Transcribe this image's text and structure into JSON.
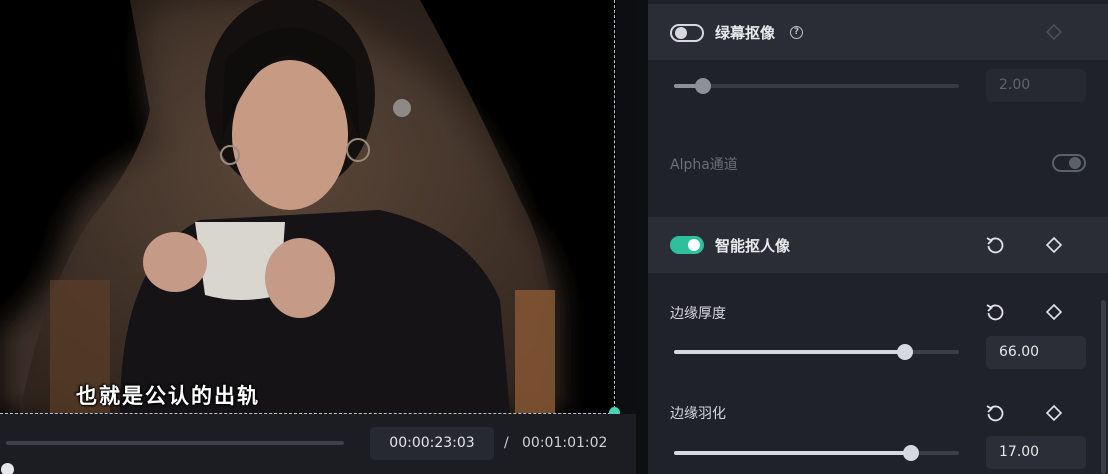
{
  "player": {
    "subtitle": "也就是公认的出轨",
    "current_time": "00:00:23:03",
    "separator": "/",
    "total_time": "00:01:01:02",
    "progress": 0.003
  },
  "panel": {
    "green_screen": {
      "title": "绿幕抠像",
      "help_icon": "?",
      "enabled": false,
      "value": "2.00",
      "level": 0.1
    },
    "alpha_channel": {
      "label": "Alpha通道",
      "enabled": false
    },
    "smart_portrait": {
      "title": "智能抠人像",
      "enabled": true,
      "edge_thickness": {
        "label": "边缘厚度",
        "value": "66.00",
        "level": 0.81
      },
      "edge_feather": {
        "label": "边缘羽化",
        "value": "17.00",
        "level": 0.83
      }
    },
    "icons": [
      "toggle-icon",
      "help-icon",
      "keyframe-diamond-icon",
      "reset-icon"
    ],
    "accent_color": "#2ebf9c"
  }
}
